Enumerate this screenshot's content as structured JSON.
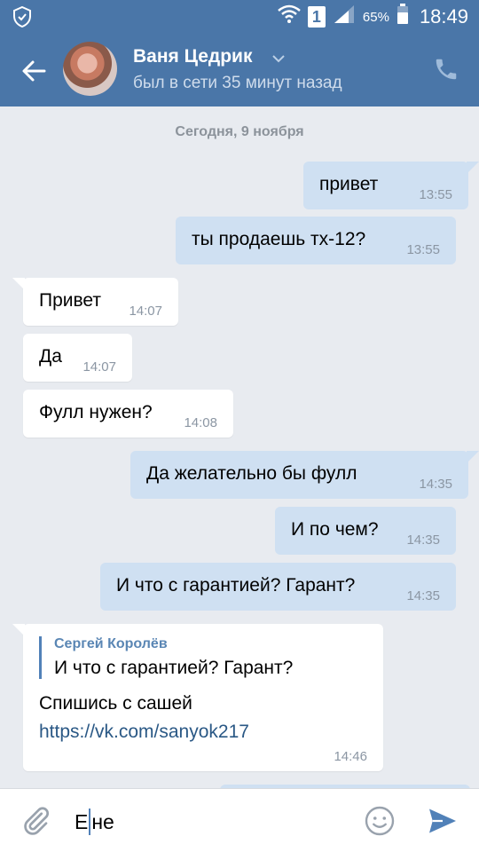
{
  "status_bar": {
    "sim_slot": "1",
    "battery_percent": "65%",
    "time": "18:49",
    "icons": [
      "shield-icon",
      "wifi-icon",
      "signal-icon",
      "battery-icon"
    ]
  },
  "header": {
    "contact_name": "Ваня Цедрик",
    "contact_status": "был в сети 35 минут назад",
    "icons": [
      "back-arrow-icon",
      "chevron-down-icon",
      "phone-icon"
    ],
    "colors": {
      "bar": "#4a76a8",
      "status_text": "#cfdcec"
    }
  },
  "chat": {
    "date_separator": "Сегодня, 9 ноября",
    "messages": [
      {
        "direction": "out",
        "text": "привет",
        "time": "13:55"
      },
      {
        "direction": "out",
        "text": "ты продаешь тх-12?",
        "time": "13:55"
      },
      {
        "direction": "in",
        "text": "Привет",
        "time": "14:07"
      },
      {
        "direction": "in",
        "text": "Да",
        "time": "14:07"
      },
      {
        "direction": "in",
        "text": "Фулл нужен?",
        "time": "14:08"
      },
      {
        "direction": "out",
        "text": "Да желательно бы фулл",
        "time": "14:35"
      },
      {
        "direction": "out",
        "text": "И по чем?",
        "time": "14:35"
      },
      {
        "direction": "out",
        "text": "И что с гарантией? Гарант?",
        "time": "14:35"
      }
    ],
    "reply_message": {
      "direction": "in",
      "quoted_author": "Сергей Королёв",
      "quoted_text": "И что с гарантией? Гарант?",
      "text": "Спишись с сашей",
      "link": "https://vk.com/sanyok217",
      "time": "14:46"
    },
    "colors": {
      "outgoing_bubble": "#cfe0f2",
      "incoming_bubble": "#ffffff",
      "background": "#e8ebf0",
      "link": "#2a5885"
    }
  },
  "input": {
    "before_cursor": "Е",
    "after_cursor": "не",
    "icons": [
      "paperclip-icon",
      "emoji-icon",
      "send-icon"
    ]
  }
}
